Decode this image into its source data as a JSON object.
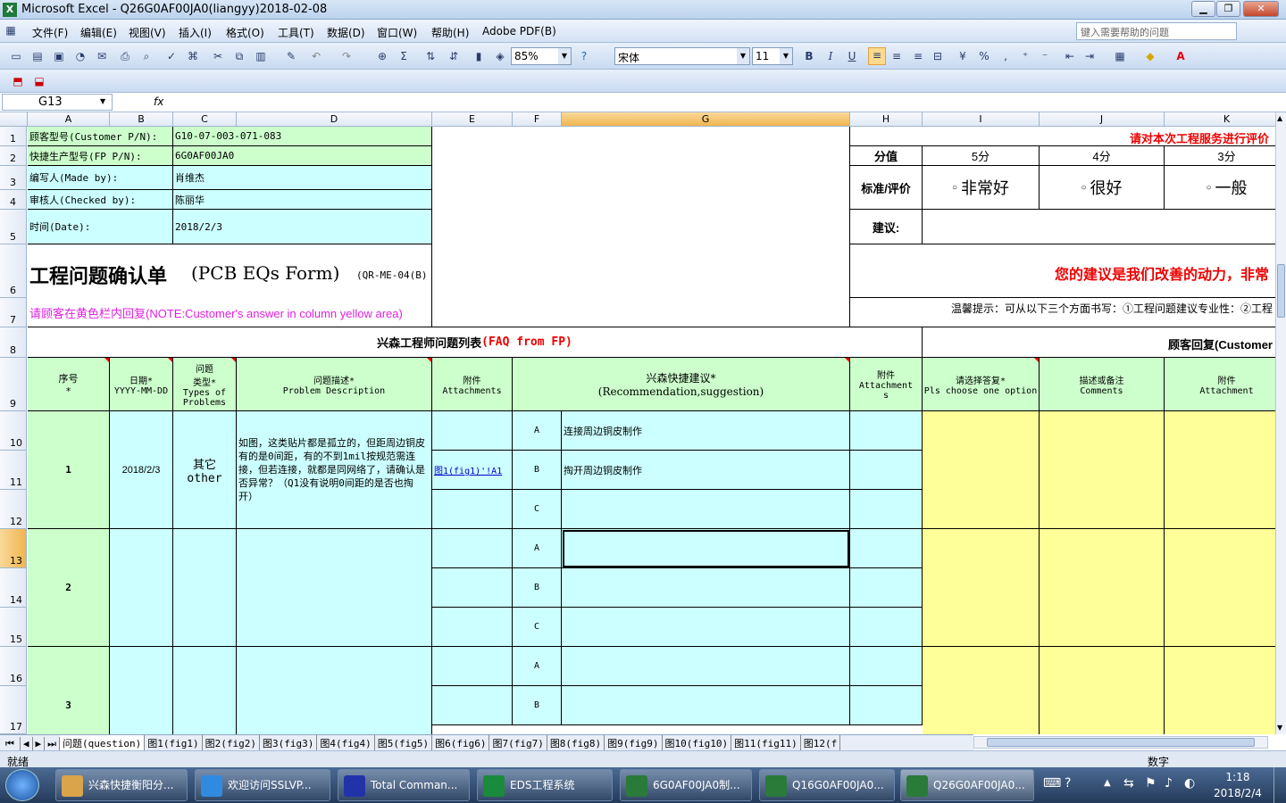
{
  "window": {
    "title": "Microsoft Excel - Q26G0AF00JA0(liangyy)2018-02-08",
    "min": "0",
    "max": "1",
    "close": "r",
    "app_icon": "excel-icon"
  },
  "menu": {
    "items": [
      "文件(F)",
      "编辑(E)",
      "视图(V)",
      "插入(I)",
      "格式(O)",
      "工具(T)",
      "数据(D)",
      "窗口(W)",
      "帮助(H)",
      "Adobe PDF(B)"
    ],
    "help_placeholder": "键入需要帮助的问题"
  },
  "toolbar": {
    "zoom": "85%",
    "font": "宋体",
    "size": "11",
    "bold": "B",
    "italic": "I",
    "underline": "U",
    "percent": "%",
    "comma": ","
  },
  "formula": {
    "namebox": "G13",
    "fx": "fx",
    "content": ""
  },
  "columns": [
    "A",
    "B",
    "C",
    "D",
    "E",
    "F",
    "G",
    "H",
    "I",
    "J",
    "K"
  ],
  "rows": [
    "1",
    "2",
    "3",
    "4",
    "5",
    "6",
    "7",
    "8",
    "9",
    "10",
    "11",
    "12",
    "13",
    "14",
    "15",
    "16",
    "17"
  ],
  "header": {
    "cust_pn_label": "顾客型号(Customer P/N):",
    "cust_pn": "G10-07-003-071-083",
    "fp_pn_label": "快捷生产型号(FP P/N):",
    "fp_pn": "6G0AF00JA0",
    "made_label": "编写人(Made by):",
    "made": "肖维杰",
    "checked_label": "审核人(Checked by):",
    "checked": "陈丽华",
    "date_label": "时间(Date):",
    "date": "2018/2/3",
    "form_title": "工程问题确认单",
    "form_title_en": "(PCB EQs Form)",
    "form_code": "(QR-ME-04(B)",
    "note": "请顾客在黄色栏内回复(NOTE:Customer's answer in column yellow area)"
  },
  "rating": {
    "banner": "请对本次工程服务进行评价",
    "score_label": "分值",
    "s5": "5分",
    "s4": "4分",
    "s3": "3分",
    "criteria_label": "标准/评价",
    "o1": "非常好",
    "o2": "很好",
    "o3": "一般",
    "suggest_label": "建议:",
    "slogan": "您的建议是我们改善的动力，非常",
    "tip": "温馨提示：可从以下三个方面书写：①工程问题建议专业性：②工程"
  },
  "faq": {
    "title": "兴森工程师问题列表",
    "title_red": "(FAQ from FP)",
    "cust_title": "顾客回复(Customer"
  },
  "th": {
    "seq": "序号\n*",
    "date": "日期*\nYYYY-MM-DD",
    "type": "问题\n类型*\nTypes of\nProblems",
    "desc": "问题描述*\nProblem Description",
    "att": "附件\nAttachments",
    "rec": "兴森快捷建议*\n(Recommendation,suggestion)",
    "att2": "附件\nAttachment\ns",
    "choose": "请选择答复*\nPls choose one option",
    "comments": "描述或备注\nComments",
    "att3": "附件\nAttachment"
  },
  "q1": {
    "no": "1",
    "date": "2018/2/3",
    "type": "其它\nother",
    "desc": "如图，这类贴片都是孤立的，但距周边铜皮有的是0间距，有的不到1mil按规范需连接，但若连接，就都是同网络了，请确认是否异常？（Q1没有说明0间距的是否也掏开）",
    "link": "图1(fig1)'!A1",
    "optA": "连接周边铜皮制作",
    "optB": "掏开周边铜皮制作",
    "optC": ""
  },
  "q2": {
    "no": "2"
  },
  "q3": {
    "no": "3"
  },
  "opts": [
    "A",
    "B",
    "C"
  ],
  "sheets": [
    "问题(question)",
    "图1(fig1)",
    "图2(fig2)",
    "图3(fig3)",
    "图4(fig4)",
    "图5(fig5)",
    "图6(fig6)",
    "图7(fig7)",
    "图8(fig8)",
    "图9(fig9)",
    "图10(fig10)",
    "图11(fig11)",
    "图12(f"
  ],
  "status": {
    "left": "就绪",
    "mode": "数字"
  },
  "taskbar": {
    "items": [
      "兴森快捷衡阳分...",
      "欢迎访问SSLVP...",
      "Total Comman...",
      "EDS工程系统",
      "6G0AF00JA0制...",
      "Q16G0AF00JA0...",
      "Q26G0AF00JA0..."
    ],
    "time": "1:18",
    "date": "2018/2/4"
  }
}
